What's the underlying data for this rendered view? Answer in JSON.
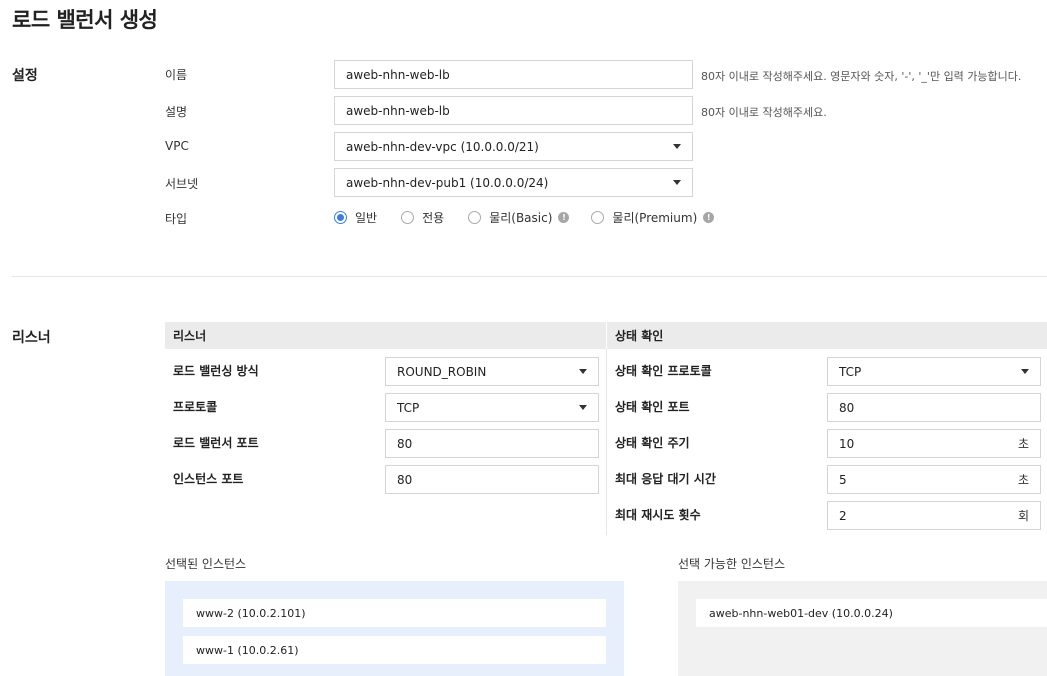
{
  "page": {
    "title": "로드 밸런서 생성"
  },
  "settings": {
    "section_title": "설정",
    "name": {
      "label": "이름",
      "value": "aweb-nhn-web-lb",
      "hint": "80자 이내로 작성해주세요. 영문자와 숫자, '-', '_'만 입력 가능합니다."
    },
    "description": {
      "label": "설명",
      "value": "aweb-nhn-web-lb",
      "hint": "80자 이내로 작성해주세요."
    },
    "vpc": {
      "label": "VPC",
      "value": "aweb-nhn-dev-vpc (10.0.0.0/21)"
    },
    "subnet": {
      "label": "서브넷",
      "value": "aweb-nhn-dev-pub1 (10.0.0.0/24)"
    },
    "type": {
      "label": "타입",
      "options": [
        {
          "label": "일반",
          "checked": true,
          "info": false
        },
        {
          "label": "전용",
          "checked": false,
          "info": false
        },
        {
          "label": "물리(Basic)",
          "checked": false,
          "info": true
        },
        {
          "label": "물리(Premium)",
          "checked": false,
          "info": true
        }
      ]
    }
  },
  "listener": {
    "section_title": "리스너",
    "left_header": "리스너",
    "right_header": "상태 확인",
    "algorithm": {
      "label": "로드 밸런싱 방식",
      "value": "ROUND_ROBIN"
    },
    "protocol": {
      "label": "프로토콜",
      "value": "TCP"
    },
    "lb_port": {
      "label": "로드 밸런서 포트",
      "value": "80"
    },
    "instance_port": {
      "label": "인스턴스 포트",
      "value": "80"
    },
    "hc_protocol": {
      "label": "상태 확인 프로토콜",
      "value": "TCP"
    },
    "hc_port": {
      "label": "상태 확인 포트",
      "value": "80"
    },
    "hc_interval": {
      "label": "상태 확인 주기",
      "value": "10",
      "unit": "초"
    },
    "hc_timeout": {
      "label": "최대 응답 대기 시간",
      "value": "5",
      "unit": "초"
    },
    "hc_retries": {
      "label": "최대 재시도 횟수",
      "value": "2",
      "unit": "회"
    }
  },
  "instances": {
    "selected_title": "선택된 인스턴스",
    "available_title": "선택 가능한 인스턴스",
    "selected": [
      "www-2 (10.0.2.101)",
      "www-1 (10.0.2.61)"
    ],
    "available": [
      "aweb-nhn-web01-dev (10.0.0.24)"
    ]
  }
}
